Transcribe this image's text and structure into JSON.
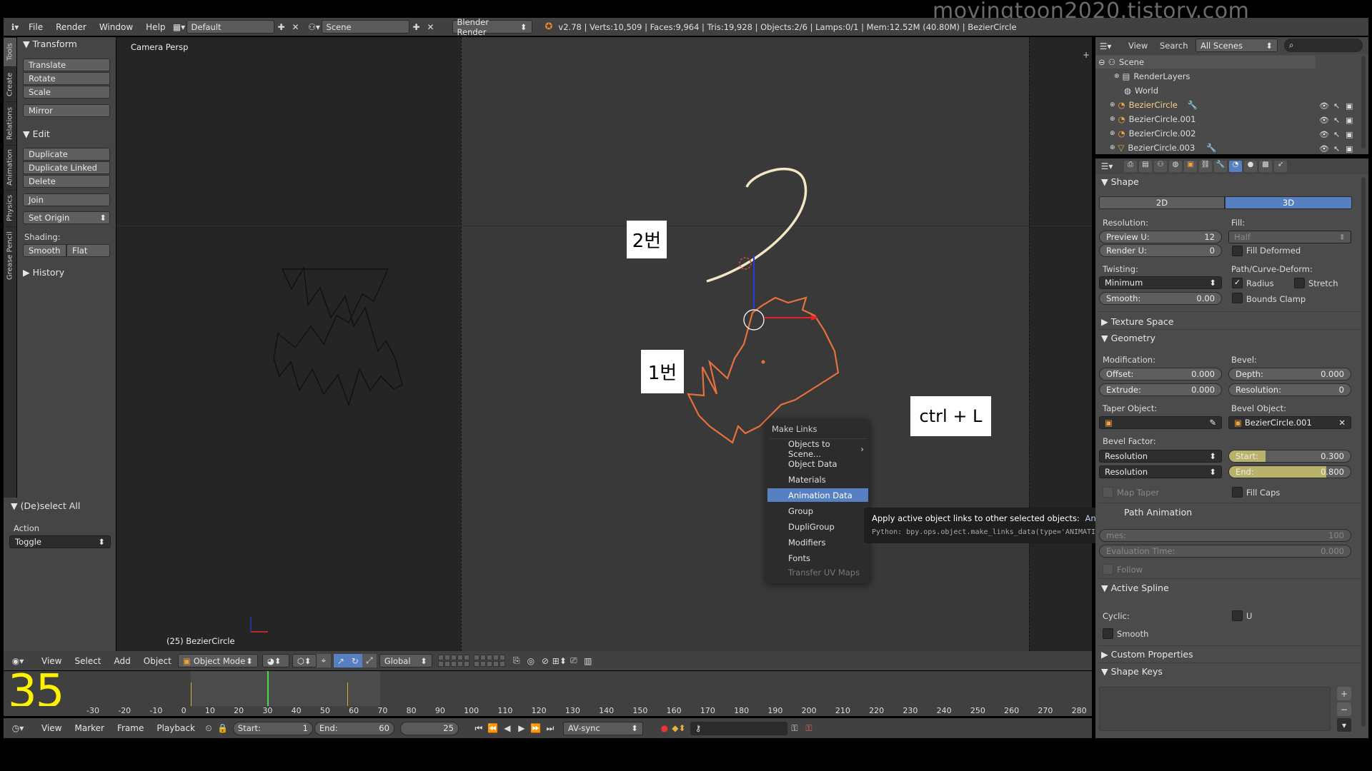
{
  "watermark": "movingtoon2020.tistory.com",
  "frame_number": "35",
  "topbar": {
    "menus": [
      "File",
      "Render",
      "Window",
      "Help"
    ],
    "layout": "Default",
    "scene": "Scene",
    "engine": "Blender Render",
    "stats": "v2.78 | Verts:10,509 | Faces:9,964 | Tris:19,928 | Objects:2/6 | Lamps:0/1 | Mem:12.52M (40.80M) | BezierCircle"
  },
  "tabs": [
    "Tools",
    "Create",
    "Relations",
    "Animation",
    "Physics",
    "Grease Pencil"
  ],
  "toolshelf": {
    "transform": {
      "title": "Transform",
      "buttons": [
        "Translate",
        "Rotate",
        "Scale"
      ],
      "mirror": "Mirror"
    },
    "edit": {
      "title": "Edit",
      "buttons": [
        "Duplicate",
        "Duplicate Linked",
        "Delete"
      ],
      "join": "Join",
      "set_origin": "Set Origin"
    },
    "shading": {
      "label": "Shading:",
      "smooth": "Smooth",
      "flat": "Flat"
    },
    "history": "History"
  },
  "last_op": {
    "title": "(De)select All",
    "action_label": "Action",
    "action_value": "Toggle"
  },
  "viewport": {
    "view_name": "Camera Persp",
    "object_info": "(25) BezierCircle"
  },
  "annotations": {
    "label2": "2번",
    "label1": "1번",
    "shortcut": "ctrl + L"
  },
  "popup": {
    "title": "Make Links",
    "items": [
      "Objects to Scene...",
      "Object Data",
      "Materials",
      "Animation Data",
      "Group",
      "DupliGroup",
      "Modifiers",
      "Fonts",
      "Transfer UV Maps"
    ],
    "highlighted": "Animation Data"
  },
  "tooltip": {
    "text": "Apply active object links to other selected objects:",
    "value": "Animation Data",
    "python": "Python: bpy.ops.object.make_links_data(type='ANIMATION')"
  },
  "outliner": {
    "view": "View",
    "search": "Search",
    "filter": "All Scenes",
    "items": [
      "Scene",
      "RenderLayers",
      "World",
      "BezierCircle",
      "BezierCircle.001",
      "BezierCircle.002",
      "BezierCircle.003"
    ]
  },
  "properties": {
    "shape": "Shape",
    "btn2d": "2D",
    "btn3d": "3D",
    "resolution": "Resolution:",
    "fill": "Fill:",
    "fill_value": "Half",
    "preview_u_label": "Preview U:",
    "preview_u": "12",
    "render_u_label": "Render U:",
    "render_u": "0",
    "fill_deformed": "Fill Deformed",
    "twisting": "Twisting:",
    "twisting_value": "Minimum",
    "path_deform": "Path/Curve-Deform:",
    "radius": "Radius",
    "stretch": "Stretch",
    "smooth_label": "Smooth:",
    "smooth_value": "0.00",
    "bounds_clamp": "Bounds Clamp",
    "texture_space": "Texture Space",
    "geometry": "Geometry",
    "modification": "Modification:",
    "bevel": "Bevel:",
    "offset_label": "Offset:",
    "offset": "0.000",
    "depth_label": "Depth:",
    "depth": "0.000",
    "extrude_label": "Extrude:",
    "extrude": "0.000",
    "bres_label": "Resolution:",
    "bres": "0",
    "taper_object": "Taper Object:",
    "bevel_object": "Bevel Object:",
    "bevel_object_value": "BezierCircle.001",
    "bevel_factor": "Bevel Factor:",
    "bf_mode1": "Resolution",
    "bf_start_label": "Start:",
    "bf_start": "0.300",
    "bf_start_fraction": 0.3,
    "bf_mode2": "Resolution",
    "bf_end_label": "End:",
    "bf_end": "0.800",
    "bf_end_fraction": 0.8,
    "map_taper": "Map Taper",
    "fill_caps": "Fill Caps",
    "path_animation": "Path Animation",
    "frames_label": "mes:",
    "frames": "100",
    "eval_label": "Evaluation Time:",
    "eval": "0.000",
    "follow": "Follow",
    "active_spline": "Active Spline",
    "cyclic": "Cyclic:",
    "u": "U",
    "smooth2": "Smooth",
    "custom_props": "Custom Properties",
    "shape_keys": "Shape Keys"
  },
  "vp_header": {
    "menus": [
      "View",
      "Select",
      "Add",
      "Object"
    ],
    "mode": "Object Mode",
    "orientation": "Global"
  },
  "timeline": {
    "ticks": [
      "-30",
      "-20",
      "-10",
      "0",
      "10",
      "20",
      "30",
      "40",
      "50",
      "60",
      "70",
      "80",
      "90",
      "100",
      "110",
      "120",
      "130",
      "140",
      "150",
      "160",
      "170",
      "180",
      "190",
      "200",
      "210",
      "220",
      "230",
      "240",
      "250",
      "260",
      "270",
      "280"
    ],
    "menus": [
      "View",
      "Marker",
      "Frame",
      "Playback"
    ],
    "start_label": "Start:",
    "start": "1",
    "end_label": "End:",
    "end": "60",
    "current": "25",
    "sync": "AV-sync"
  }
}
